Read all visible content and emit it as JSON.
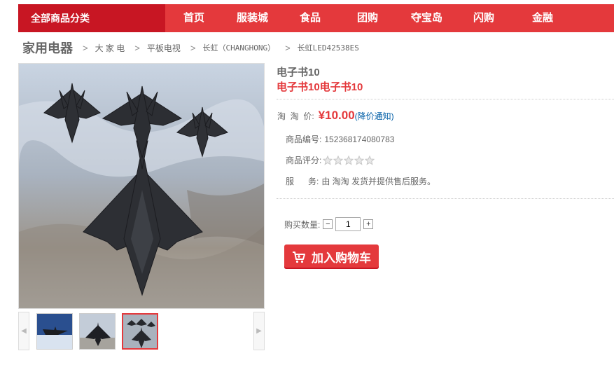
{
  "nav": {
    "category": "全部商品分类",
    "items": [
      "首页",
      "服装城",
      "食品",
      "团购",
      "夺宝岛",
      "闪购",
      "金融"
    ]
  },
  "breadcrumb": {
    "root": "家用电器",
    "sep": ">",
    "items": [
      "大 家 电",
      "平板电视",
      "长虹（CHANGHONG）",
      "长虹LED42538ES"
    ]
  },
  "product": {
    "title": "电子书10",
    "subtitle": "电子书10电子书10",
    "price_label": "淘  淘  价:",
    "price": "¥10.00",
    "notice": "(降价通知)",
    "code_label": "商品编号:",
    "code": "152368174080783",
    "rating_label": "商品评分:",
    "rating": 0,
    "rating_max": 5,
    "service_label": "服      务:",
    "service": "由 淘淘 发货并提供售后服务。",
    "qty_label": "购买数量:",
    "qty": "1",
    "minus": "−",
    "plus": "+",
    "cart_label": "加入购物车"
  },
  "thumbs": {
    "prev": "◀",
    "next": "▶",
    "count": 3,
    "selected": 2
  },
  "colors": {
    "brand": "#e4393c",
    "brand_dark": "#c81623",
    "link": "#005ea7"
  },
  "icons": {
    "cart": "cart-icon",
    "star": "star-icon"
  }
}
